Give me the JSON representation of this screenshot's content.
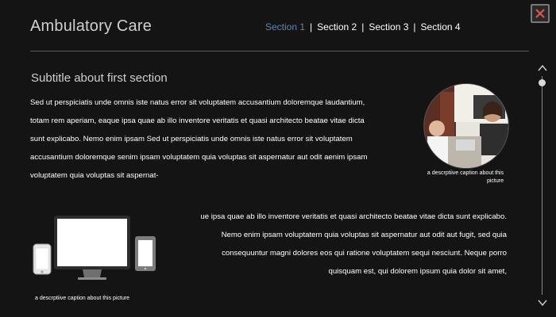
{
  "header": {
    "title": "Ambulatory Care",
    "nav": [
      "Section 1",
      "Section 2",
      "Section 3",
      "Section 4"
    ],
    "active_index": 0,
    "separator": "|"
  },
  "main": {
    "subtitle": "Subtitle about first section",
    "paragraph_1": "Sed ut perspiciatis unde omnis iste natus error sit voluptatem accusantium doloremque laudantium, totam rem aperiam, eaque ipsa quae ab illo inventore veritatis et quasi architecto beatae vitae dicta sunt explicabo. Nemo enim ipsam Sed ut perspiciatis unde omnis iste natus error sit voluptatem accusantium doloremque senim ipsam voluptatem quia voluptas sit aspernatur aut odit aenim ipsam voluptatem quia voluptas sit aspernat-",
    "paragraph_2": "ue ipsa quae ab illo inventore veritatis et quasi architecto beatae vitae dicta sunt explicabo. Nemo enim ipsam voluptatem quia voluptas sit aspernatur aut odit aut fugit, sed quia consequuntur magni dolores eos qui ratione voluptatem sequi nesciunt. Neque porro quisquam est, qui dolorem ipsum quia dolor sit amet,",
    "photo_caption": "a descrptiive caption about this picture",
    "devices_caption": "a descrptiive caption about this picture"
  },
  "icons": {
    "close": "close-icon",
    "scroll_up": "chevron-up-icon",
    "scroll_down": "chevron-down-icon"
  },
  "colors": {
    "background": "#151414",
    "active_tab": "#5d86b8",
    "title": "#cfcfcf",
    "divider": "#5a5a5a"
  },
  "scroll": {
    "position": 0
  }
}
